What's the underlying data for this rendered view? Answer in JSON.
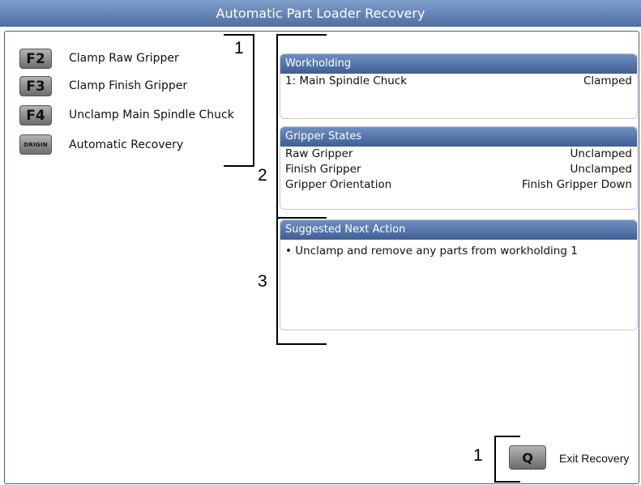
{
  "window": {
    "title": "Automatic Part Loader Recovery"
  },
  "keys": [
    {
      "key": "F2",
      "label": "Clamp Raw Gripper"
    },
    {
      "key": "F3",
      "label": "Clamp Finish Gripper"
    },
    {
      "key": "F4",
      "label": "Unclamp Main Spindle Chuck"
    },
    {
      "key": "ORIGIN",
      "label": "Automatic Recovery"
    }
  ],
  "workholding": {
    "title": "Workholding",
    "rows": [
      {
        "name": "1: Main Spindle Chuck",
        "value": "Clamped"
      }
    ]
  },
  "gripper_states": {
    "title": "Gripper States",
    "rows": [
      {
        "name": "Raw Gripper",
        "value": "Unclamped"
      },
      {
        "name": "Finish Gripper",
        "value": "Unclamped"
      },
      {
        "name": "Gripper Orientation",
        "value": "Finish Gripper Down"
      }
    ]
  },
  "suggested": {
    "title": "Suggested Next Action",
    "text": "• Unclamp and remove any parts from workholding 1"
  },
  "exit": {
    "key": "Q",
    "label": "Exit Recovery"
  },
  "callouts": {
    "one": "1",
    "two": "2",
    "three": "3",
    "exit": "1"
  }
}
